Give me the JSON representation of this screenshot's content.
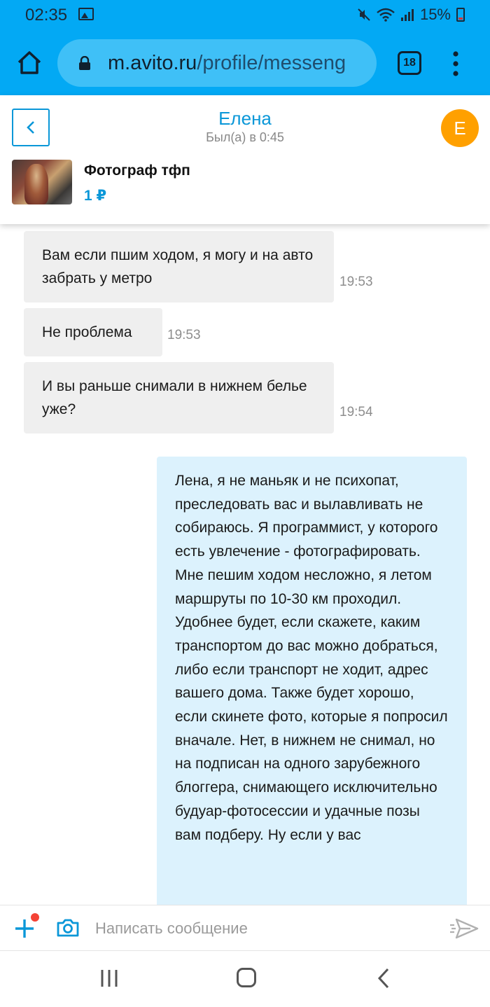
{
  "status_bar": {
    "time": "02:35",
    "battery": "15%"
  },
  "browser": {
    "url_domain": "m.avito.ru",
    "url_path": "/profile/messeng",
    "tab_count": "18"
  },
  "chat": {
    "contact_name": "Елена",
    "contact_status": "Был(а) в 0:45",
    "avatar_letter": "Е",
    "avatar_color": "#ffa000",
    "listing_title": "Фотограф тфп",
    "listing_price": "1 ₽",
    "accent_color": "#0a97d8"
  },
  "messages": {
    "incoming": [
      {
        "text": "Вам если пшим ходом, я могу и на авто забрать у метро",
        "time": "19:53"
      },
      {
        "text": "Не проблема",
        "time": "19:53"
      },
      {
        "text": "И вы раньше снимали в нижнем белье уже?",
        "time": "19:54"
      }
    ],
    "outgoing": [
      {
        "text": "Лена, я не маньяк и не психопат, преследовать вас и вылавливать не собираюсь. Я программист, у которого есть увлечение - фотографировать. Мне пешим ходом несложно, я летом маршруты по 10-30 км проходил. Удобнее будет, если скажете, каким транспортом до вас можно добраться, либо если транспорт не ходит, адрес вашего дома. Также будет хорошо, если скинете фото, которые я попросил вначале. Нет, в нижнем не снимал, но на подписан на одного зарубежного блоггера, снимающего исключительно будуар-фотосессии и удачные позы вам подберу. Ну если у вас"
      }
    ]
  },
  "composer": {
    "placeholder": "Написать сообщение"
  }
}
